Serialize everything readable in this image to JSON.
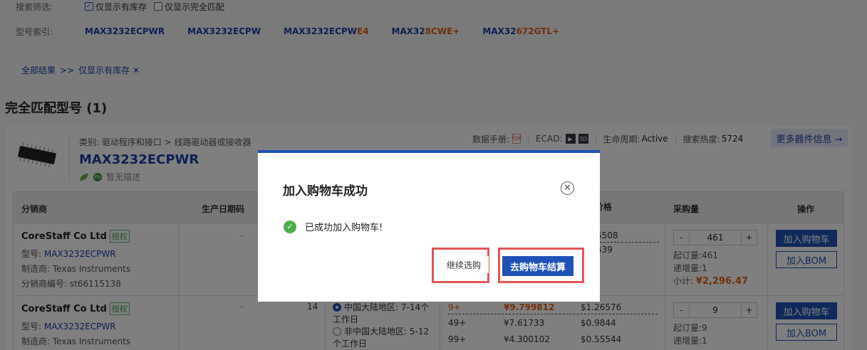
{
  "filters": {
    "search_label": "搜索筛选:",
    "in_stock_label": "仅显示有库存",
    "in_stock_checked": true,
    "exact_match_label": "仅显示完全匹配",
    "exact_match_checked": false,
    "index_label": "型号索引:",
    "index_items": [
      {
        "base": "MAX3232ECPWR",
        "suffix": ""
      },
      {
        "base": "MAX3232ECPW",
        "suffix": ""
      },
      {
        "base": "MAX3232ECPW",
        "suffix": "E4"
      },
      {
        "base": "MAX32",
        "suffix": "8CWE+"
      },
      {
        "base": "MAX32",
        "suffix": "672GTL+"
      }
    ]
  },
  "crumbs": {
    "all": "全部结果",
    "sep": ">>",
    "current": "仅显示有库存",
    "remove": "✕"
  },
  "section_title": "完全匹配型号 (1)",
  "product": {
    "category": "类别: 驱动程序和接口 > 线路驱动器或接收器",
    "part": "MAX3232ECPWR",
    "pb_label": "Pb",
    "desc": "暂无描述",
    "datasheet_label": "数据手册:",
    "ecad_label": "ECAD:",
    "ecad_icons": [
      "▶",
      "3D"
    ],
    "lifecycle_label": "生命周期:",
    "lifecycle_value": "Active",
    "heat_label": "搜索热度:",
    "heat_value": "5724",
    "more_info": "更多器件信息 →"
  },
  "table": {
    "headers": {
      "distributor": "分销商",
      "date_code": "生产日期码",
      "price": "价格",
      "purchase_qty": "采购量",
      "action": "操作"
    },
    "rows": [
      {
        "distributor": "CoreStaff Co Ltd",
        "auth": "授权",
        "model_label": "型号:",
        "model": "MAX3232ECPWR",
        "maker_label": "制造商:",
        "maker": "Texas Instruments",
        "sku_label": "分销商编号:",
        "sku": "st66115138",
        "date_code": "-",
        "prices_partial": [
          "5508",
          "439"
        ],
        "qty": "461",
        "min_order": "起订量:461",
        "step": "递增量:1",
        "subtotal_label": "小计:",
        "subtotal": "¥2,296.47",
        "add_cart": "加入购物车",
        "add_bom": "加入BOM"
      },
      {
        "distributor": "CoreStaff Co Ltd",
        "auth": "授权",
        "model_label": "型号:",
        "model": "MAX3232ECPWR",
        "maker_label": "制造商:",
        "maker": "Texas Instruments",
        "date_code": "-",
        "stock": "14",
        "region_1": "中国大陆地区: 7-14个工作日",
        "region_2": "非中国大陆地区: 5-12个工作日",
        "price_rows": [
          {
            "qty": "9+",
            "cny": "¥9.799812",
            "usd": "$1.26576"
          },
          {
            "qty": "49+",
            "cny": "¥7.61733",
            "usd": "$0.9844"
          },
          {
            "qty": "99+",
            "cny": "¥4.300102",
            "usd": "$0.55544"
          }
        ],
        "qty": "9",
        "min_order": "起订量:9",
        "step": "递增量:1",
        "add_cart": "加入购物车",
        "add_bom": "加入BOM"
      }
    ],
    "minus": "-",
    "plus": "+"
  },
  "modal": {
    "title": "加入购物车成功",
    "close": "✕",
    "message": "已成功加入购物车!",
    "ok_icon": "✓",
    "continue": "继续选购",
    "checkout": "去购物车结算"
  },
  "colors": {
    "accent": "#1f52b6",
    "highlight": "#e4610f",
    "annotation_red": "#e05656",
    "success": "#4cae4c"
  }
}
